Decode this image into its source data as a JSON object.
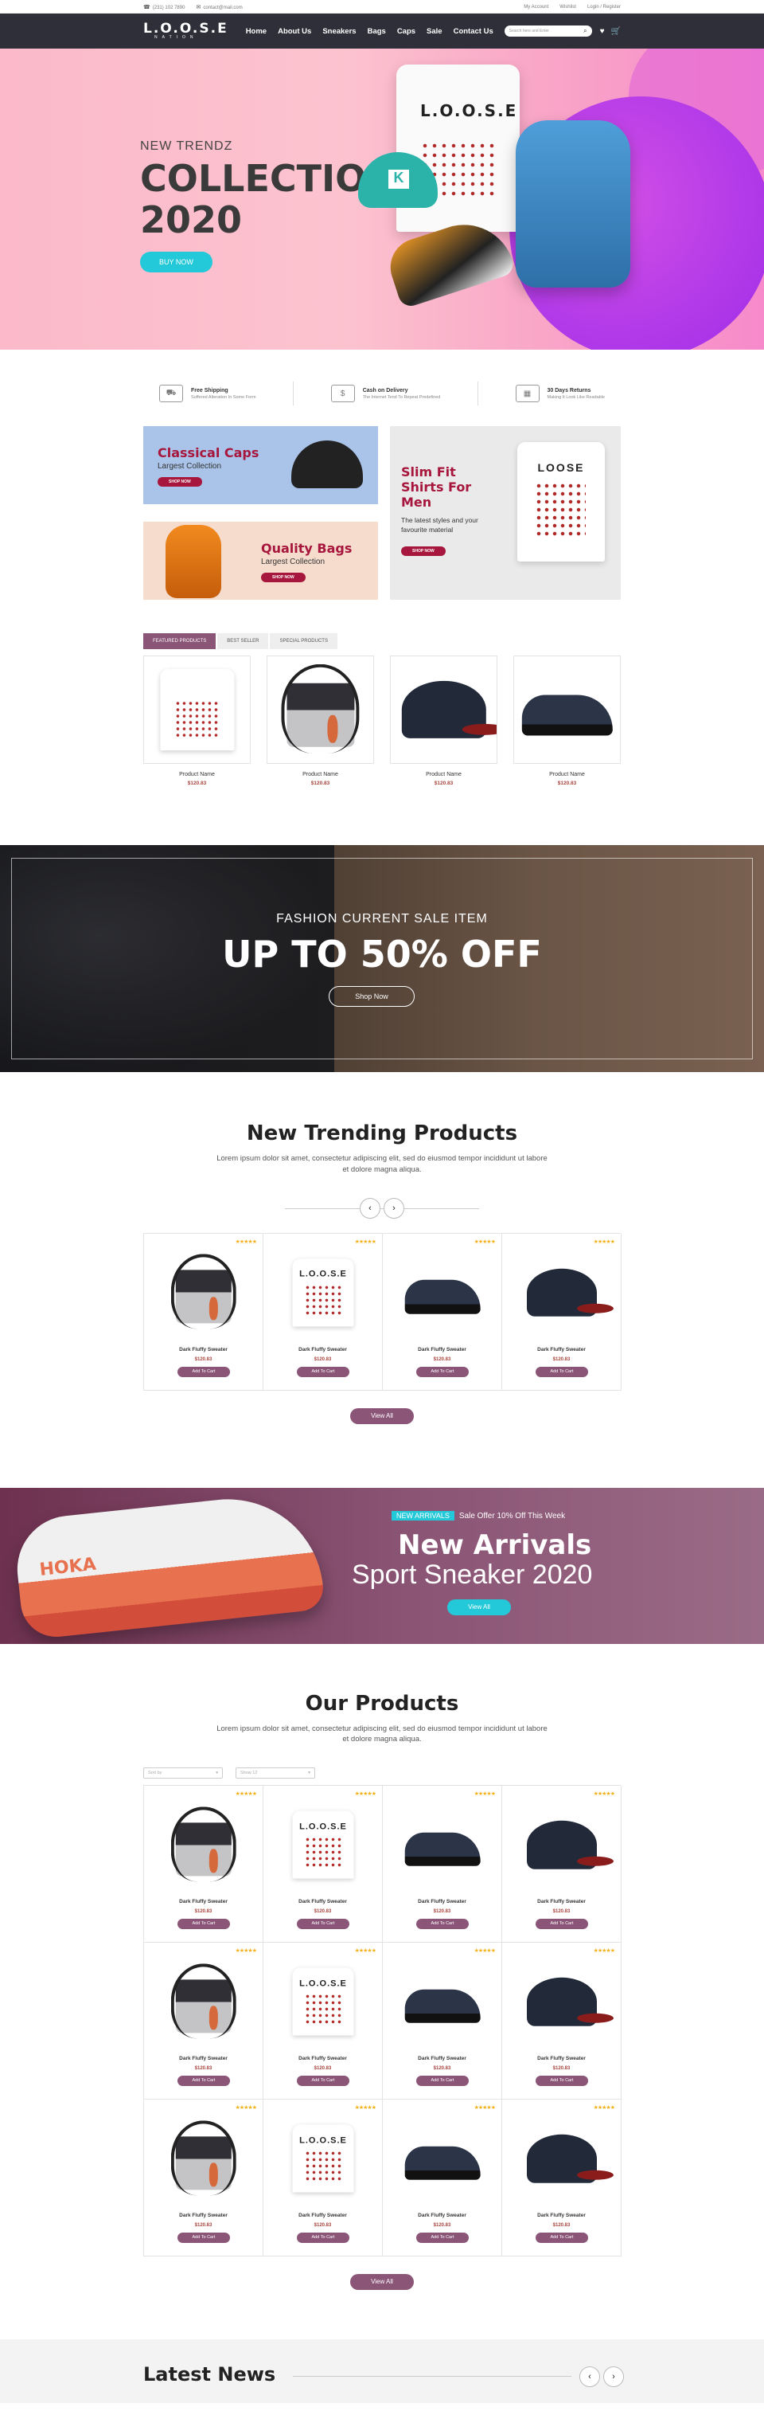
{
  "topbar": {
    "phone": "(231) 102 7890",
    "email": "contact@mail.com",
    "my_account": "My Account",
    "wishlist": "Wishlist",
    "login": "Login / Register"
  },
  "nav": {
    "logo": "L.O.O.S.E",
    "logo_sub": "NATION",
    "menu": [
      "Home",
      "About Us",
      "Sneakers",
      "Bags",
      "Caps",
      "Sale",
      "Contact Us"
    ],
    "search_placeholder": "Search here and Enter"
  },
  "hero": {
    "subtitle": "NEW TRENDZ",
    "title_line1": "COLLECTION",
    "title_line2": "2020",
    "button": "BUY NOW",
    "shirt_logo": "L.O.O.S.E"
  },
  "features": [
    {
      "icon": "truck-icon",
      "title": "Free Shipping",
      "desc": "Suffered Alteration In Some Form"
    },
    {
      "icon": "cash-icon",
      "title": "Cash on Delivery",
      "desc": "The Internet Tend To Repeat Predefined"
    },
    {
      "icon": "calendar-icon",
      "title": "30 Days Returns",
      "desc": "Making It Look Like Readable"
    }
  ],
  "banners": {
    "caps": {
      "title": "Classical Caps",
      "subtitle": "Largest Collection",
      "button": "SHOP NOW"
    },
    "bags": {
      "title": "Quality Bags",
      "subtitle": "Largest Collection",
      "button": "SHOP NOW"
    },
    "shirts": {
      "title": "Slim Fit Shirts For Men",
      "subtitle": "The latest styles and your favourite material",
      "button": "SHOP NOW",
      "shirt_text": "LOOSE"
    }
  },
  "tabs": [
    "FEATURED PRODUCTS",
    "BEST SELLER",
    "SPECIAL PRODUCTS"
  ],
  "featured": [
    {
      "type": "tee",
      "name": "Product Name",
      "price": "$120.83"
    },
    {
      "type": "bag",
      "name": "Product Name",
      "price": "$120.83"
    },
    {
      "type": "cap",
      "name": "Product Name",
      "price": "$120.83"
    },
    {
      "type": "shoe",
      "name": "Product Name",
      "price": "$120.83"
    }
  ],
  "sale": {
    "subtitle": "FASHION CURRENT SALE ITEM",
    "title": "UP TO 50% OFF",
    "button": "Shop Now"
  },
  "trending": {
    "title": "New Trending Products",
    "desc": "Lorem ipsum dolor sit amet, consectetur adipiscing elit, sed do eiusmod tempor incididunt ut labore et dolore magna aliqua.",
    "products": [
      {
        "type": "bag",
        "name": "Dark Fluffy Sweater",
        "price": "$120.83",
        "button": "Add To Cart"
      },
      {
        "type": "tee",
        "name": "Dark Fluffy Sweater",
        "price": "$120.83",
        "button": "Add To Cart"
      },
      {
        "type": "shoe",
        "name": "Dark Fluffy Sweater",
        "price": "$120.83",
        "button": "Add To Cart"
      },
      {
        "type": "cap",
        "name": "Dark Fluffy Sweater",
        "price": "$120.83",
        "button": "Add To Cart"
      }
    ],
    "view_all": "View All"
  },
  "arrivals": {
    "badge": "NEW ARRIVALS",
    "offer": "Sale Offer 10% Off This Week",
    "title1": "New Arrivals",
    "title2": "Sport Sneaker 2020",
    "button": "View All",
    "shoe_brand": "HOKA"
  },
  "our_products": {
    "title": "Our Products",
    "desc": "Lorem ipsum dolor sit amet, consectetur adipiscing elit, sed do eiusmod tempor incididunt ut labore et dolore magna aliqua.",
    "selects": [
      "Sort by",
      "Show 12"
    ],
    "rows": [
      [
        {
          "type": "bag",
          "name": "Dark Fluffy Sweater",
          "price": "$120.83",
          "button": "Add To Cart"
        },
        {
          "type": "tee",
          "name": "Dark Fluffy Sweater",
          "price": "$120.83",
          "button": "Add To Cart"
        },
        {
          "type": "shoe",
          "name": "Dark Fluffy Sweater",
          "price": "$120.83",
          "button": "Add To Cart"
        },
        {
          "type": "cap",
          "name": "Dark Fluffy Sweater",
          "price": "$120.83",
          "button": "Add To Cart"
        }
      ],
      [
        {
          "type": "bag",
          "name": "Dark Fluffy Sweater",
          "price": "$120.83",
          "button": "Add To Cart"
        },
        {
          "type": "tee",
          "name": "Dark Fluffy Sweater",
          "price": "$120.83",
          "button": "Add To Cart"
        },
        {
          "type": "shoe",
          "name": "Dark Fluffy Sweater",
          "price": "$120.83",
          "button": "Add To Cart"
        },
        {
          "type": "cap",
          "name": "Dark Fluffy Sweater",
          "price": "$120.83",
          "button": "Add To Cart"
        }
      ],
      [
        {
          "type": "bag",
          "name": "Dark Fluffy Sweater",
          "price": "$120.83",
          "button": "Add To Cart"
        },
        {
          "type": "tee",
          "name": "Dark Fluffy Sweater",
          "price": "$120.83",
          "button": "Add To Cart"
        },
        {
          "type": "shoe",
          "name": "Dark Fluffy Sweater",
          "price": "$120.83",
          "button": "Add To Cart"
        },
        {
          "type": "cap",
          "name": "Dark Fluffy Sweater",
          "price": "$120.83",
          "button": "Add To Cart"
        }
      ]
    ],
    "view_all": "View All"
  },
  "news": {
    "title": "Latest News"
  },
  "colors": {
    "accent": "#8b5578",
    "cyan": "#23c9d8",
    "nav": "#2e2f39",
    "price": "#a8453e",
    "star": "#f3b21c"
  },
  "stars": "★★★★★"
}
